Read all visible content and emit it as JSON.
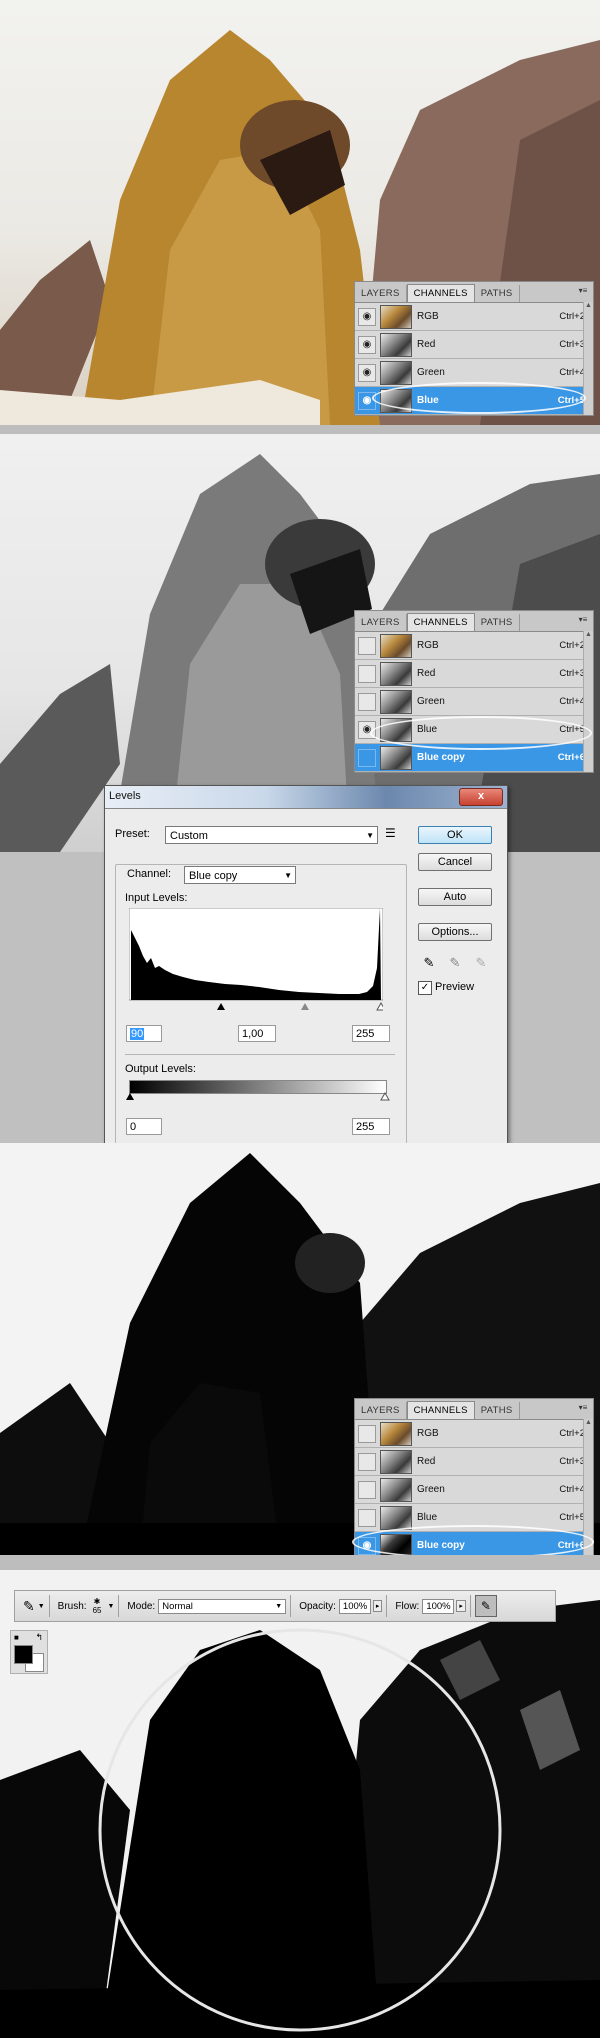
{
  "colors": {
    "selection": "#3a97e6",
    "panel_bg": "#d6d6d6"
  },
  "panels": [
    {
      "tabs": [
        "LAYERS",
        "CHANNELS",
        "PATHS"
      ],
      "active_tab": "CHANNELS",
      "channels": [
        {
          "name": "RGB",
          "shortcut": "Ctrl+2",
          "visible": true,
          "selected": false
        },
        {
          "name": "Red",
          "shortcut": "Ctrl+3",
          "visible": true,
          "selected": false
        },
        {
          "name": "Green",
          "shortcut": "Ctrl+4",
          "visible": true,
          "selected": false
        },
        {
          "name": "Blue",
          "shortcut": "Ctrl+5",
          "visible": true,
          "selected": true
        }
      ]
    },
    {
      "tabs": [
        "LAYERS",
        "CHANNELS",
        "PATHS"
      ],
      "active_tab": "CHANNELS",
      "channels": [
        {
          "name": "RGB",
          "shortcut": "Ctrl+2",
          "visible": false,
          "selected": false
        },
        {
          "name": "Red",
          "shortcut": "Ctrl+3",
          "visible": false,
          "selected": false
        },
        {
          "name": "Green",
          "shortcut": "Ctrl+4",
          "visible": false,
          "selected": false
        },
        {
          "name": "Blue",
          "shortcut": "Ctrl+5",
          "visible": true,
          "selected": false
        },
        {
          "name": "Blue copy",
          "shortcut": "Ctrl+6",
          "visible": false,
          "selected": true
        }
      ]
    },
    {
      "tabs": [
        "LAYERS",
        "CHANNELS",
        "PATHS"
      ],
      "active_tab": "CHANNELS",
      "channels": [
        {
          "name": "RGB",
          "shortcut": "Ctrl+2",
          "visible": false,
          "selected": false
        },
        {
          "name": "Red",
          "shortcut": "Ctrl+3",
          "visible": false,
          "selected": false
        },
        {
          "name": "Green",
          "shortcut": "Ctrl+4",
          "visible": false,
          "selected": false
        },
        {
          "name": "Blue",
          "shortcut": "Ctrl+5",
          "visible": false,
          "selected": false
        },
        {
          "name": "Blue copy",
          "shortcut": "Ctrl+6",
          "visible": true,
          "selected": true
        }
      ]
    }
  ],
  "levels": {
    "title": "Levels",
    "close": "x",
    "preset_label": "Preset:",
    "preset_value": "Custom",
    "channel_label": "Channel:",
    "channel_value": "Blue copy",
    "input_levels_label": "Input Levels:",
    "input_black": "90",
    "input_gamma": "1,00",
    "input_white": "255",
    "output_levels_label": "Output Levels:",
    "output_black": "0",
    "output_white": "255",
    "ok": "OK",
    "cancel": "Cancel",
    "auto": "Auto",
    "options": "Options...",
    "preview_label": "Preview",
    "preview_checked": true
  },
  "brush_toolbar": {
    "brush_label": "Brush:",
    "brush_size": "65",
    "mode_label": "Mode:",
    "mode_value": "Normal",
    "opacity_label": "Opacity:",
    "opacity_value": "100%",
    "flow_label": "Flow:",
    "flow_value": "100%"
  }
}
